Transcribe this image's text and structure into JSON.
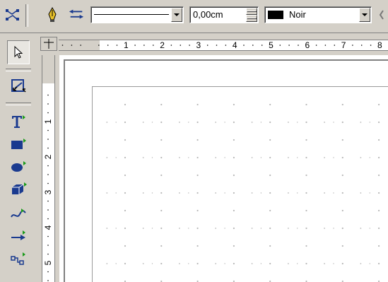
{
  "toolbar": {
    "line_width_value": "0,00cm",
    "line_color_name": "Noir",
    "line_color_swatch": "#000000",
    "icons": [
      "points-icon",
      "pen-icon",
      "arrow-style-icon",
      "line-style-preview"
    ]
  },
  "ruler": {
    "horizontal_numbers": [
      "1",
      "2",
      "3",
      "4",
      "5",
      "6",
      "7",
      "8"
    ],
    "vertical_numbers": [
      "1",
      "2",
      "3",
      "4",
      "5"
    ]
  },
  "tools": [
    "select-tool",
    "zoom-tool",
    "text-tool",
    "rectangle-tool",
    "ellipse-tool",
    "3d-objects-tool",
    "curve-tool",
    "lines-arrows-tool",
    "connector-tool"
  ],
  "colors": {
    "toolbar_bg": "#d4d0c8",
    "canvas_bg": "#ffffff",
    "grid_dot": "#b8b8b8"
  }
}
